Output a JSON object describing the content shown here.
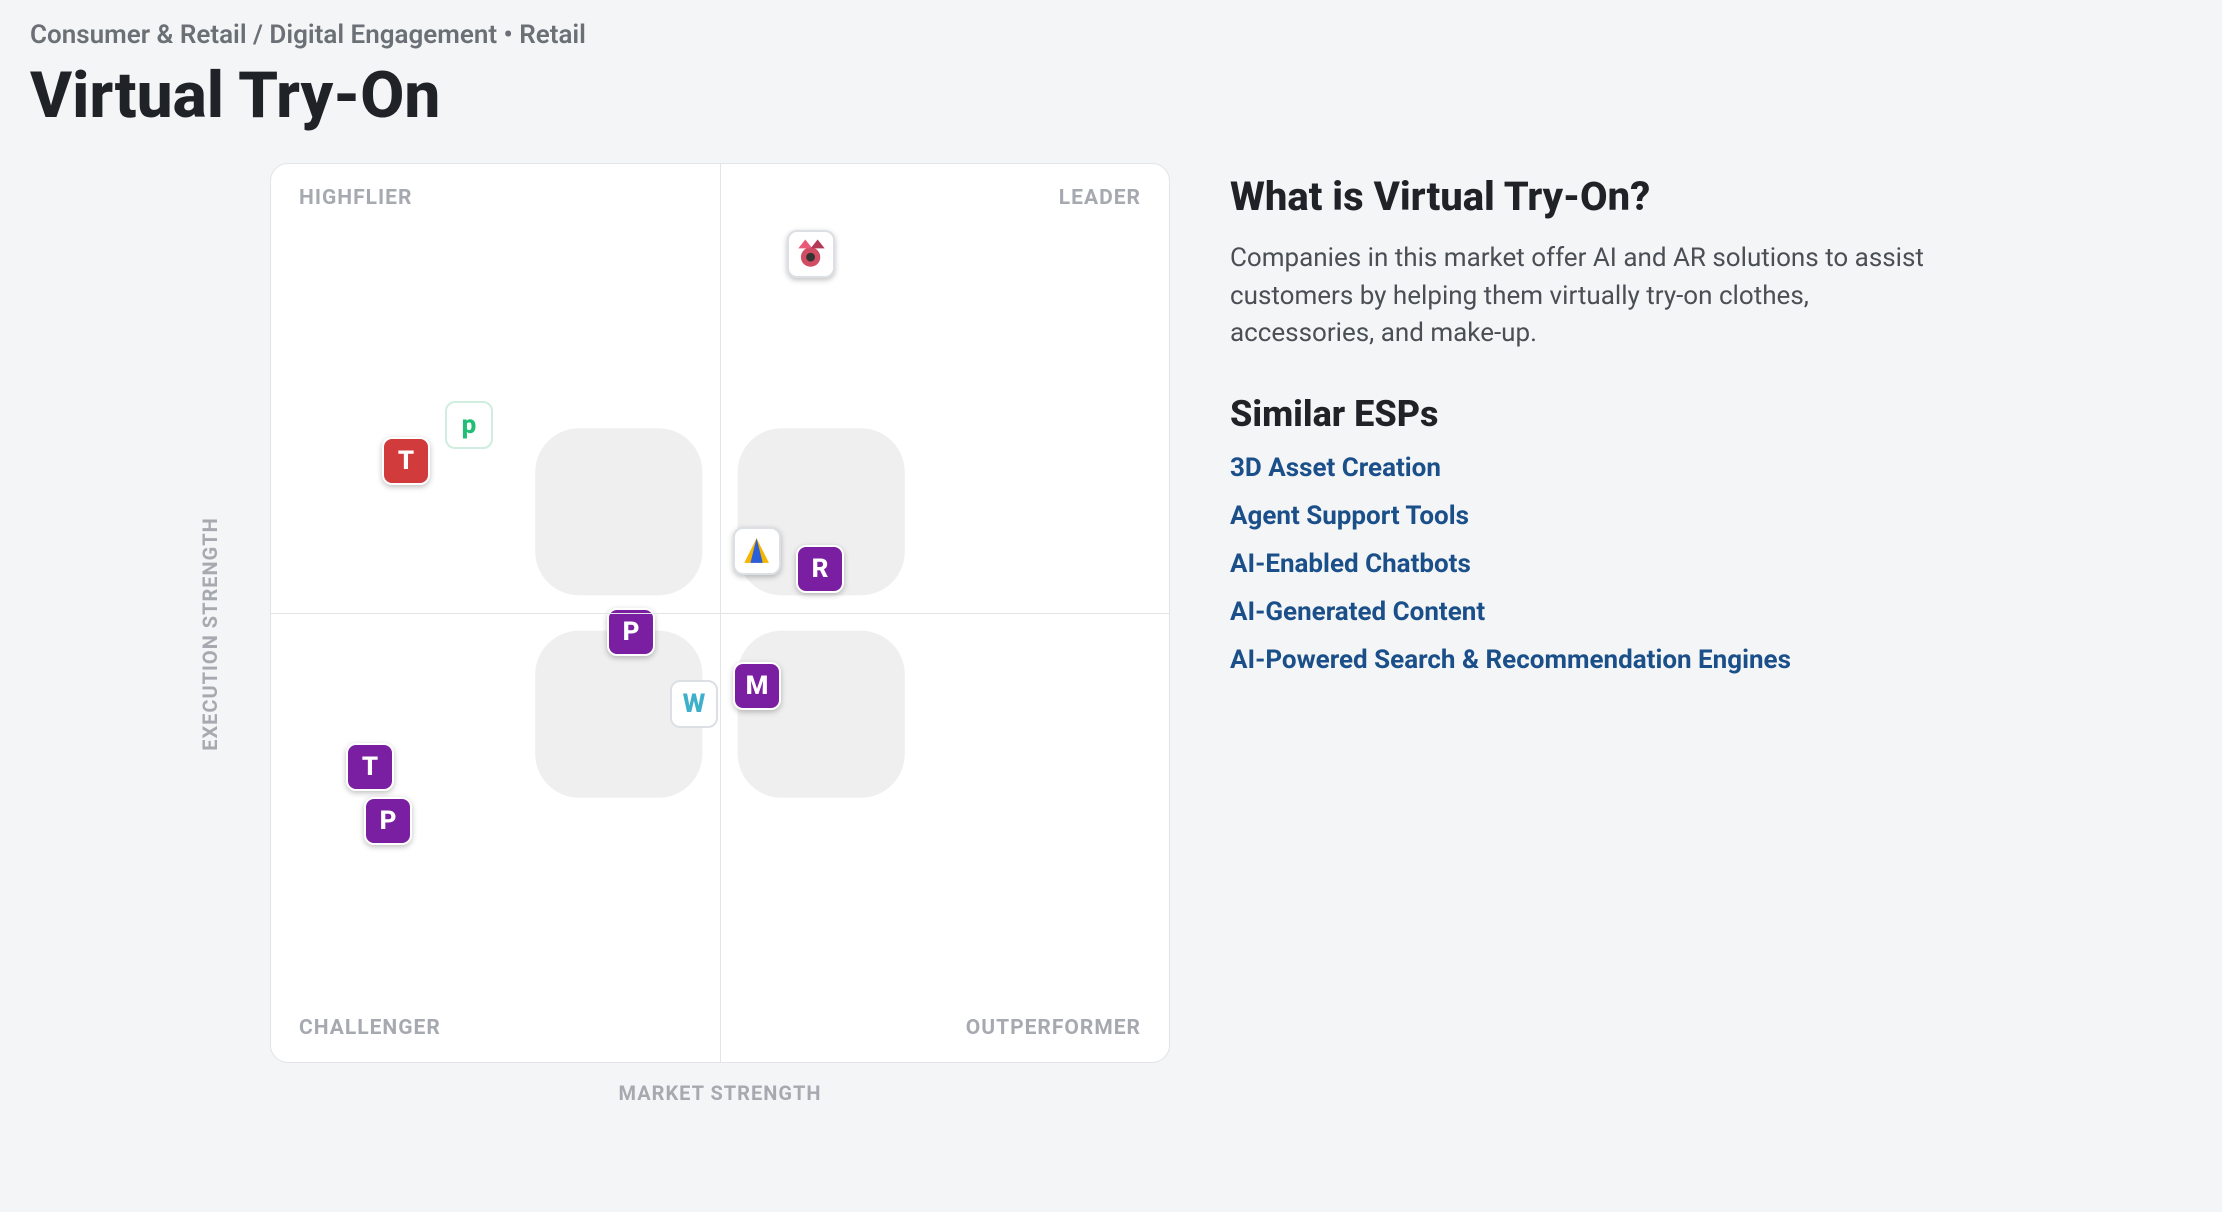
{
  "breadcrumb": "Consumer & Retail / Digital Engagement • Retail",
  "title": "Virtual Try-On",
  "sidebar": {
    "heading": "What is Virtual Try-On?",
    "description": "Companies in this market offer AI and AR solutions to assist customers by helping them virtually try-on clothes, accessories, and make-up.",
    "similar_heading": "Similar ESPs",
    "similar_links": [
      "3D Asset Creation",
      "Agent Support Tools",
      "AI-Enabled Chatbots",
      "AI-Generated Content",
      "AI-Powered Search & Recommendation Engines"
    ]
  },
  "chart_data": {
    "type": "scatter",
    "title": "Virtual Try-On",
    "xlabel": "MARKET STRENGTH",
    "ylabel": "EXECUTION STRENGTH",
    "xlim": [
      0,
      100
    ],
    "ylim": [
      0,
      100
    ],
    "quadrants": {
      "top_left": "HIGHFLIER",
      "top_right": "LEADER",
      "bottom_left": "CHALLENGER",
      "bottom_right": "OUTPERFORMER"
    },
    "points": [
      {
        "label": "Perfect (YouCam)",
        "letter": "",
        "x": 60,
        "y": 90,
        "style": "image",
        "bg": "#ffffff"
      },
      {
        "label": "p",
        "letter": "p",
        "x": 22,
        "y": 71,
        "style": "letter",
        "bg": "#ffffff",
        "fg": "#1fbf75",
        "border": "#cfeee0"
      },
      {
        "label": "T (Try)",
        "letter": "T",
        "x": 15,
        "y": 67,
        "style": "letter",
        "bg": "#d13b3b",
        "fg": "#ffffff"
      },
      {
        "label": "A (logo)",
        "letter": "",
        "x": 54,
        "y": 57,
        "style": "image",
        "bg": "#ffffff"
      },
      {
        "label": "R",
        "letter": "R",
        "x": 61,
        "y": 55,
        "style": "letter",
        "bg": "#7b1fa2",
        "fg": "#ffffff"
      },
      {
        "label": "P",
        "letter": "P",
        "x": 40,
        "y": 48,
        "style": "letter",
        "bg": "#7b1fa2",
        "fg": "#ffffff"
      },
      {
        "label": "M",
        "letter": "M",
        "x": 54,
        "y": 42,
        "style": "letter",
        "bg": "#7b1fa2",
        "fg": "#ffffff"
      },
      {
        "label": "W",
        "letter": "W",
        "x": 47,
        "y": 40,
        "style": "letter",
        "bg": "#ffffff",
        "fg": "#3fb0c9",
        "border": "#dcdfe3"
      },
      {
        "label": "T",
        "letter": "T",
        "x": 11,
        "y": 33,
        "style": "letter",
        "bg": "#7b1fa2",
        "fg": "#ffffff"
      },
      {
        "label": "P (lower)",
        "letter": "P",
        "x": 13,
        "y": 27,
        "style": "letter",
        "bg": "#7b1fa2",
        "fg": "#ffffff"
      }
    ]
  }
}
